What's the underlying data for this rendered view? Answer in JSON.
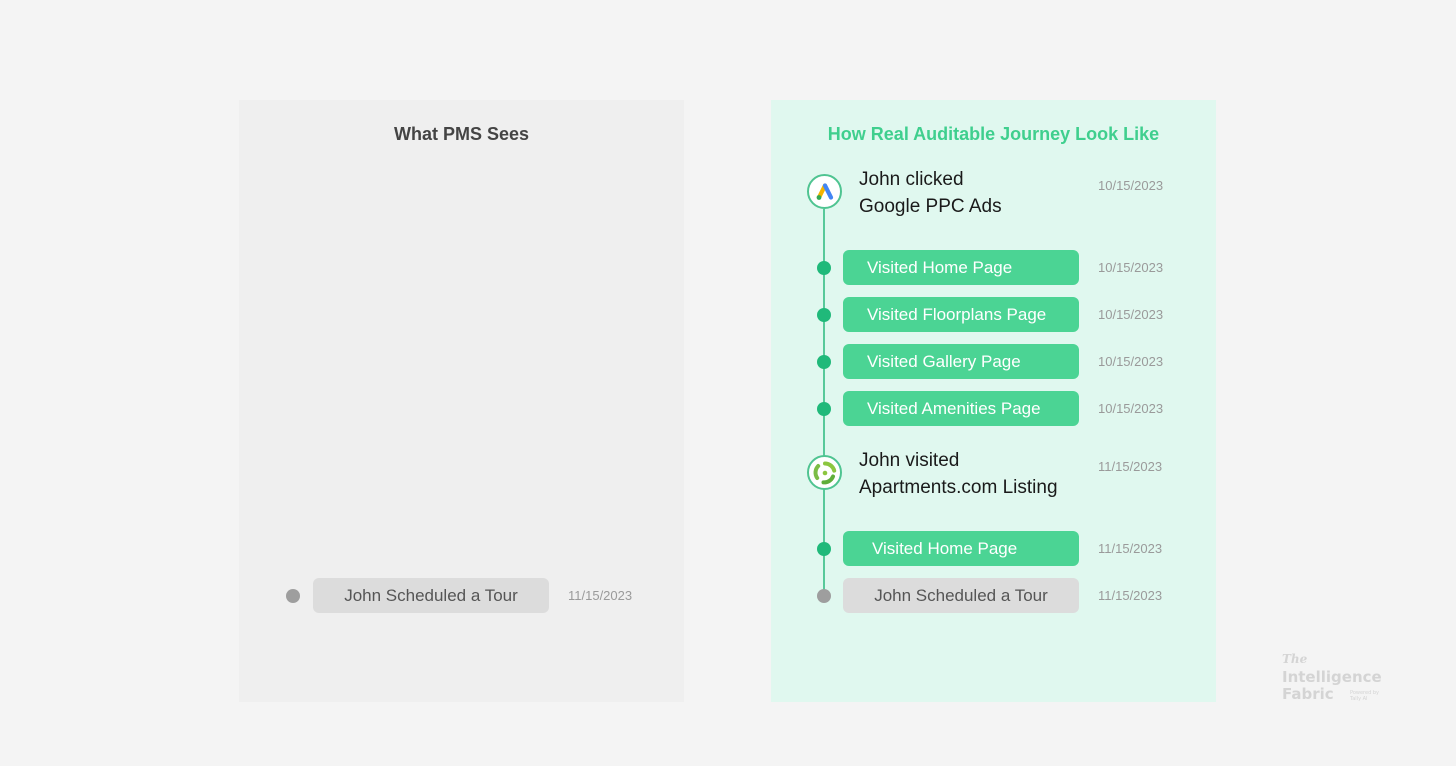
{
  "left_panel": {
    "title": "What PMS Sees",
    "event": {
      "label": "John Scheduled a Tour",
      "date": "11/15/2023"
    }
  },
  "right_panel": {
    "title": "How Real Auditable Journey Look Like",
    "events": [
      {
        "type": "source",
        "icon": "google-ads-icon",
        "line1": "John clicked",
        "line2": "Google PPC Ads",
        "date": "10/15/2023"
      },
      {
        "type": "page",
        "label": "Visited Home Page",
        "date": "10/15/2023"
      },
      {
        "type": "page",
        "label": "Visited Floorplans Page",
        "date": "10/15/2023"
      },
      {
        "type": "page",
        "label": "Visited Gallery Page",
        "date": "10/15/2023"
      },
      {
        "type": "page",
        "label": "Visited Amenities Page",
        "date": "10/15/2023"
      },
      {
        "type": "source",
        "icon": "apartments-com-icon",
        "line1": "John visited",
        "line2": "Apartments.com Listing",
        "date": "11/15/2023"
      },
      {
        "type": "page",
        "label": "Visited Home Page",
        "date": "11/15/2023"
      },
      {
        "type": "conversion",
        "label": "John Scheduled a Tour",
        "date": "11/15/2023"
      }
    ]
  },
  "brand": {
    "the": "The",
    "line1": "Intelligence",
    "line2": "Fabric",
    "tagline_1": "Powered by",
    "tagline_2": "Tally AI"
  },
  "colors": {
    "accent_green": "#3fcf8e",
    "pill_green": "#4bd494",
    "dot_green": "#20b97a",
    "neutral_gray": "#9e9e9e",
    "right_panel_bg": "#e0f8ef",
    "left_panel_bg": "#efefef"
  }
}
